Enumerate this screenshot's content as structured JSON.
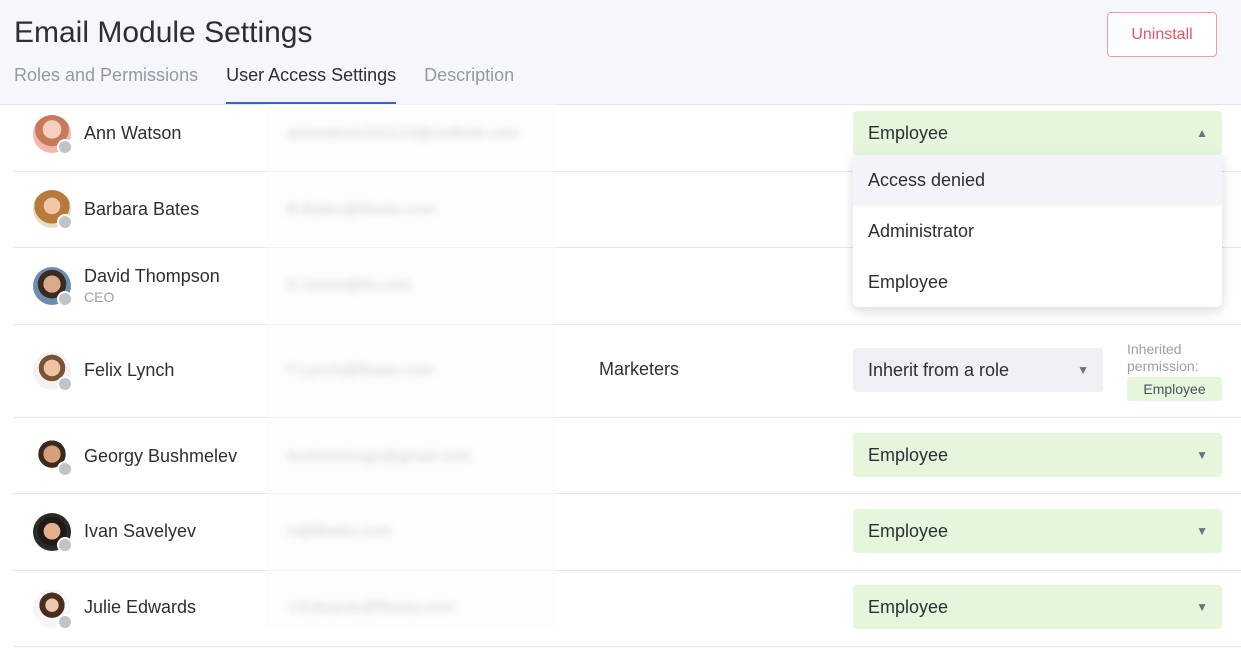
{
  "header": {
    "title": "Email Module Settings",
    "uninstall_label": "Uninstall",
    "tabs": [
      {
        "label": "Roles and Permissions",
        "active": false
      },
      {
        "label": "User Access Settings",
        "active": true
      },
      {
        "label": "Description",
        "active": false
      }
    ]
  },
  "users": [
    {
      "name": "Ann Watson",
      "subtitle": "",
      "email": "annwatson201123@outlook.com",
      "role": "",
      "access": "Employee",
      "expanded": true
    },
    {
      "name": "Barbara Bates",
      "subtitle": "",
      "email": "B.Bates@flowtu.com",
      "role": "",
      "access": ""
    },
    {
      "name": "David Thompson",
      "subtitle": "CEO",
      "email": "D.Smart@fw.com",
      "role": "",
      "access": ""
    },
    {
      "name": "Felix Lynch",
      "subtitle": "",
      "email": "F.Lynch@flowtu.com",
      "role": "Marketers",
      "access": "Inherit from a role",
      "inherited_label": "Inherited permission:",
      "inherited_value": "Employee"
    },
    {
      "name": "Georgy Bushmelev",
      "subtitle": "",
      "email": "bushmelevgs@gmail.com",
      "role": "",
      "access": "Employee"
    },
    {
      "name": "Ivan Savelyev",
      "subtitle": "",
      "email": "is@flowtu.com",
      "role": "",
      "access": "Employee"
    },
    {
      "name": "Julie Edwards",
      "subtitle": "",
      "email": "J.Edwards@flowtu.com",
      "role": "",
      "access": "Employee"
    }
  ],
  "dropdown": {
    "options": [
      "Access denied",
      "Administrator",
      "Employee"
    ],
    "highlighted": "Access denied"
  },
  "colors": {
    "accent": "#3b63c7",
    "danger": "#e0566b",
    "select_green": "#e6f6dc",
    "select_grey": "#eef0f4"
  },
  "icons": [
    "chevron-up-icon",
    "chevron-down-icon",
    "status-dot-icon"
  ]
}
